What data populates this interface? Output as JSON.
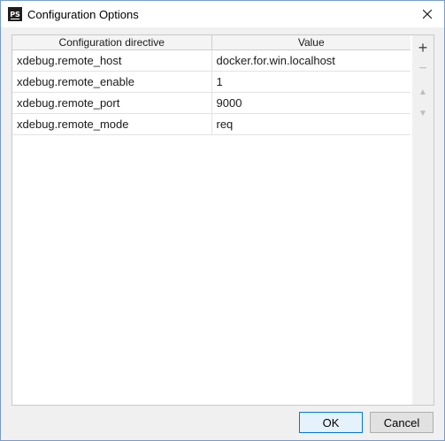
{
  "window": {
    "title": "Configuration Options",
    "app_icon_text": "PS"
  },
  "table": {
    "columns": [
      "Configuration directive",
      "Value"
    ],
    "rows": [
      {
        "directive": "xdebug.remote_host",
        "value": "docker.for.win.localhost"
      },
      {
        "directive": "xdebug.remote_enable",
        "value": "1"
      },
      {
        "directive": "xdebug.remote_port",
        "value": "9000"
      },
      {
        "directive": "xdebug.remote_mode",
        "value": "req"
      }
    ]
  },
  "toolbar": {
    "add": "+",
    "remove": "−",
    "up": "▲",
    "down": "▼"
  },
  "buttons": {
    "ok": "OK",
    "cancel": "Cancel"
  },
  "colors": {
    "accent": "#0078d7",
    "window_border": "#7a9cc7"
  }
}
